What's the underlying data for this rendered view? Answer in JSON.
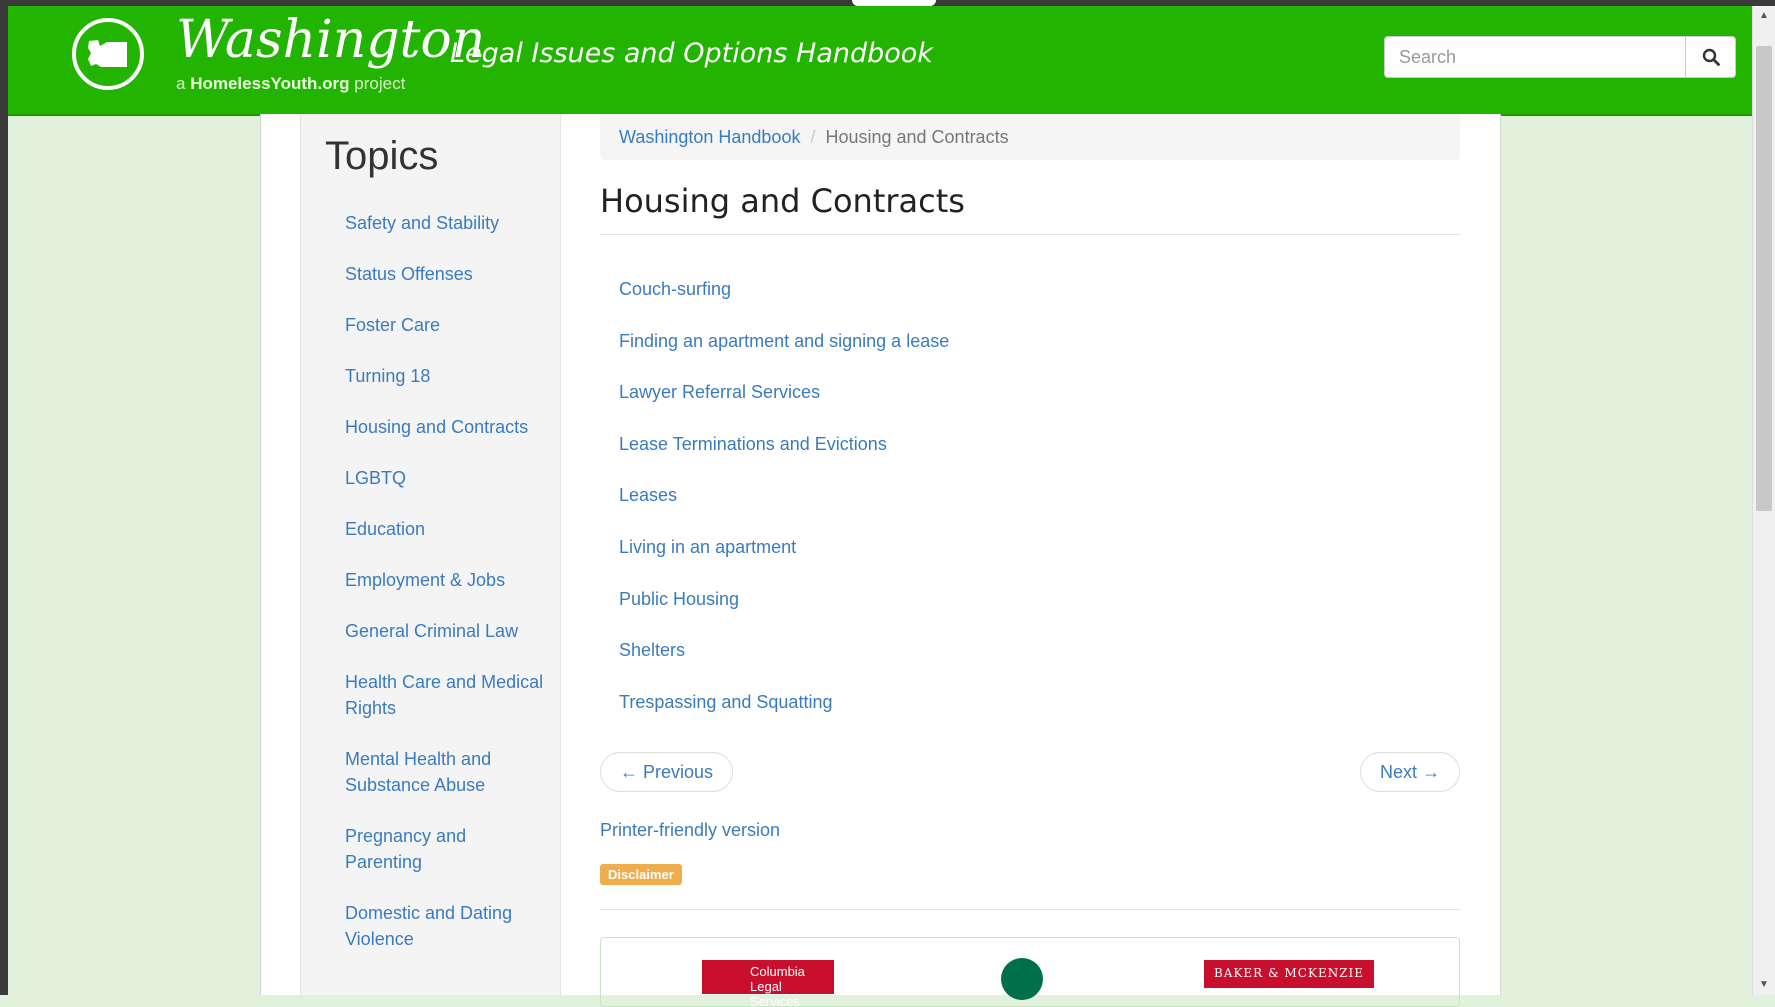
{
  "header": {
    "title": "Washington",
    "subtitle_prefix": "a",
    "subtitle_brand": "HomelessYouth.org",
    "subtitle_suffix": "project",
    "tagline": "Legal Issues and Options Handbook",
    "search_placeholder": "Search",
    "search_icon": "magnifier-icon",
    "logo_icon": "washington-state-icon"
  },
  "sidebar": {
    "title": "Topics",
    "items": [
      "Safety and Stability",
      "Status Offenses",
      "Foster Care",
      "Turning 18",
      "Housing and Contracts",
      "LGBTQ",
      "Education",
      "Employment & Jobs",
      "General Criminal Law",
      "Health Care and Medical Rights",
      "Mental Health and Substance Abuse",
      "Pregnancy and Parenting",
      "Domestic and Dating Violence"
    ]
  },
  "breadcrumb": {
    "home": "Washington Handbook",
    "separator": "/",
    "current": "Housing and Contracts"
  },
  "main": {
    "title": "Housing and Contracts",
    "links": [
      "Couch-surfing",
      "Finding an apartment and signing a lease",
      "Lawyer Referral Services",
      "Lease Terminations and Evictions",
      "Leases",
      "Living in an apartment",
      "Public Housing",
      "Shelters",
      "Trespassing and Squatting"
    ],
    "prev_label": "← Previous",
    "next_label": "Next →",
    "printer_label": "Printer-friendly version",
    "disclaimer_label": "Disclaimer"
  },
  "sponsors": {
    "columbia": "Columbia Legal Services",
    "starbucks": "Starbucks",
    "baker": "BAKER & MCKENZIE"
  },
  "colors": {
    "header_green": "#22b400",
    "link_blue": "#3a7bbf",
    "page_bg": "#e2f1dc",
    "disclaimer_orange": "#f0ad4e"
  }
}
